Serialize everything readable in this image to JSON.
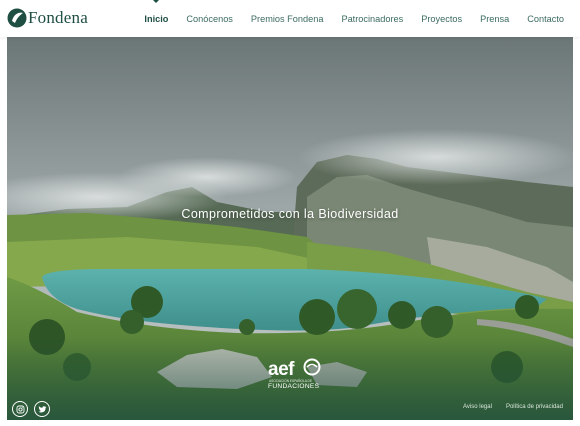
{
  "header": {
    "logo_text": "Fondena",
    "nav": [
      {
        "label": "Inicio",
        "active": true
      },
      {
        "label": "Conócenos"
      },
      {
        "label": "Premios Fondena"
      },
      {
        "label": "Patrocinadores"
      },
      {
        "label": "Proyectos"
      },
      {
        "label": "Prensa"
      },
      {
        "label": "Contacto"
      }
    ]
  },
  "hero": {
    "title": "Comprometidos con la Biodiversidad",
    "partner_logo": {
      "word": "aef",
      "tagline": "ASOCIACIÓN ESPAÑOLA DE",
      "subtitle": "FUNDACIONES"
    }
  },
  "footer": {
    "social": [
      {
        "name": "instagram-icon"
      },
      {
        "name": "twitter-icon"
      }
    ],
    "links": [
      "Aviso legal",
      "Política de privacidad"
    ]
  },
  "colors": {
    "brand_green": "#1f4f43",
    "nav_text": "#3b6b5f",
    "lake": "#4fa5a2"
  }
}
